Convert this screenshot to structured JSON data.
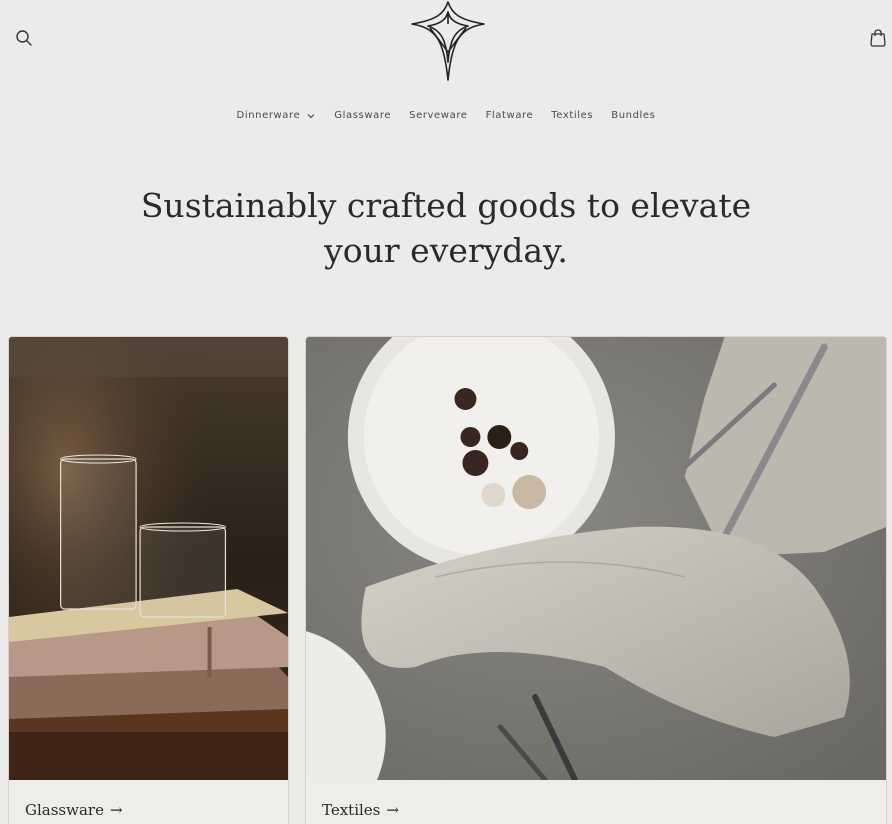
{
  "header": {
    "search_icon": "search-icon",
    "cart_icon": "cart-icon",
    "logo": "star-logo"
  },
  "nav": {
    "items": [
      {
        "label": "Dinnerware",
        "has_dropdown": true
      },
      {
        "label": "Glassware"
      },
      {
        "label": "Serveware"
      },
      {
        "label": "Flatware"
      },
      {
        "label": "Textiles"
      },
      {
        "label": "Bundles"
      }
    ]
  },
  "hero": {
    "line1": "Sustainably crafted goods to elevate",
    "line2": "your everyday."
  },
  "collections": [
    {
      "label": "Glassware",
      "arrow": "→"
    },
    {
      "label": "Textiles",
      "arrow": "→"
    }
  ],
  "colors": {
    "background": "#edebe9",
    "text": "#2b2b2b"
  }
}
